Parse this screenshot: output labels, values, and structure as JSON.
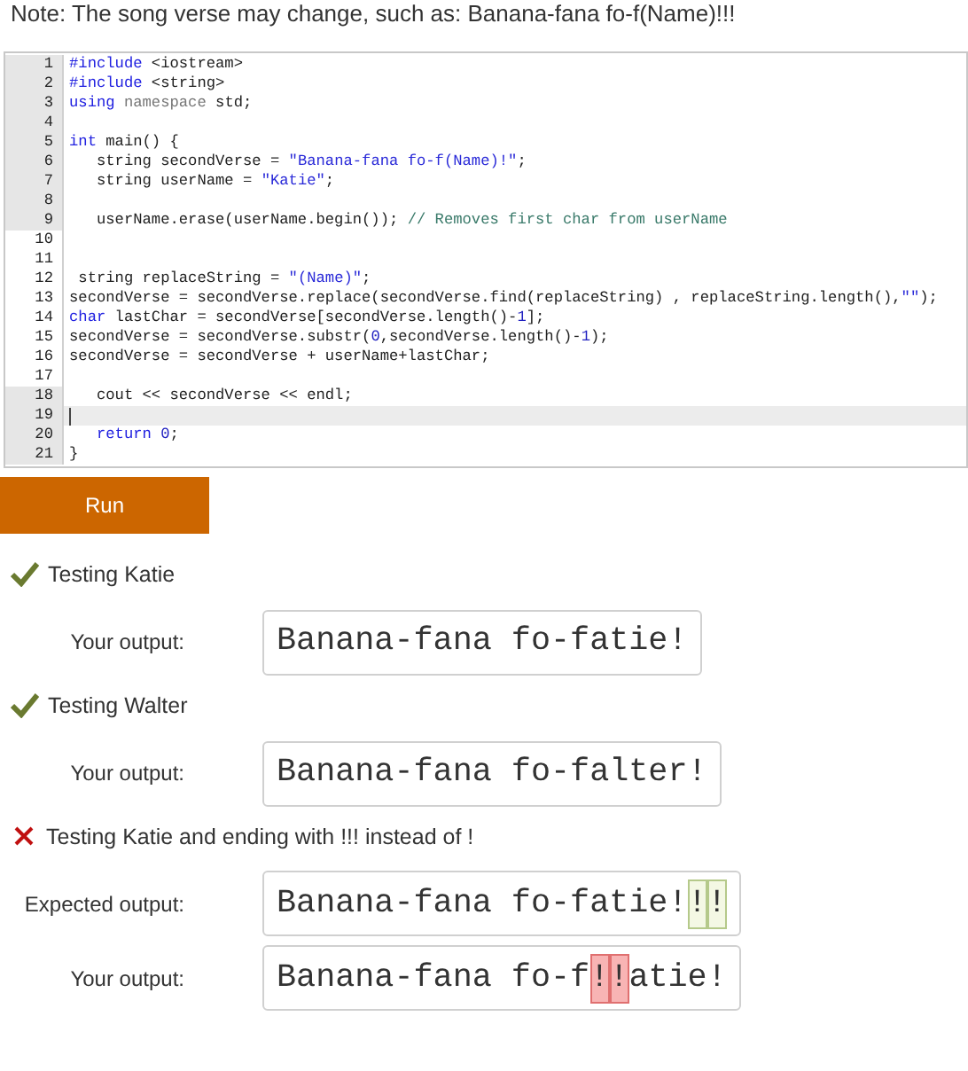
{
  "note": "Note: The song verse may change, such as: Banana-fana fo-f(Name)!!!",
  "editor": {
    "lines": [
      {
        "number": "1",
        "highlighted": true,
        "current": false,
        "tokens": [
          {
            "text": "#include",
            "kind": "keyword"
          },
          {
            "text": " <iostream>",
            "kind": "plain"
          }
        ]
      },
      {
        "number": "2",
        "highlighted": true,
        "current": false,
        "tokens": [
          {
            "text": "#include",
            "kind": "keyword"
          },
          {
            "text": " <string>",
            "kind": "plain"
          }
        ]
      },
      {
        "number": "3",
        "highlighted": true,
        "current": false,
        "tokens": [
          {
            "text": "using",
            "kind": "keyword"
          },
          {
            "text": " namespace",
            "kind": "muted"
          },
          {
            "text": " std;",
            "kind": "plain"
          }
        ]
      },
      {
        "number": "4",
        "highlighted": true,
        "current": false
      },
      {
        "number": "5",
        "highlighted": true,
        "current": false,
        "tokens": [
          {
            "text": "int",
            "kind": "keyword"
          },
          {
            "text": " main() {",
            "kind": "plain"
          }
        ]
      },
      {
        "number": "6",
        "highlighted": true,
        "current": false,
        "tokens": [
          {
            "text": "   string secondVerse = ",
            "kind": "plain"
          },
          {
            "text": "\"Banana-fana fo-f(Name)!\"",
            "kind": "string"
          },
          {
            "text": ";",
            "kind": "plain"
          }
        ]
      },
      {
        "number": "7",
        "highlighted": true,
        "current": false,
        "tokens": [
          {
            "text": "   string userName = ",
            "kind": "plain"
          },
          {
            "text": "\"Katie\"",
            "kind": "string"
          },
          {
            "text": ";",
            "kind": "plain"
          }
        ]
      },
      {
        "number": "8",
        "highlighted": true,
        "current": false
      },
      {
        "number": "9",
        "highlighted": true,
        "current": false,
        "tokens": [
          {
            "text": "   userName.erase(userName.begin()); ",
            "kind": "plain"
          },
          {
            "text": "// Removes first char from userName",
            "kind": "comment"
          }
        ]
      },
      {
        "number": "10",
        "highlighted": false,
        "current": false
      },
      {
        "number": "11",
        "highlighted": false,
        "current": false
      },
      {
        "number": "12",
        "highlighted": false,
        "current": false,
        "tokens": [
          {
            "text": " string replaceString = ",
            "kind": "plain"
          },
          {
            "text": "\"(Name)\"",
            "kind": "string"
          },
          {
            "text": ";",
            "kind": "plain"
          }
        ]
      },
      {
        "number": "13",
        "highlighted": false,
        "current": false,
        "tokens": [
          {
            "text": "secondVerse = secondVerse.replace(secondVerse.find(replaceString) , replaceString.length(),",
            "kind": "plain"
          },
          {
            "text": "\"\"",
            "kind": "string"
          },
          {
            "text": ");",
            "kind": "plain"
          }
        ]
      },
      {
        "number": "14",
        "highlighted": false,
        "current": false,
        "tokens": [
          {
            "text": "char",
            "kind": "keyword"
          },
          {
            "text": " lastChar = secondVerse[secondVerse.length()-",
            "kind": "plain"
          },
          {
            "text": "1",
            "kind": "number"
          },
          {
            "text": "];",
            "kind": "plain"
          }
        ]
      },
      {
        "number": "15",
        "highlighted": false,
        "current": false,
        "tokens": [
          {
            "text": "secondVerse = secondVerse.substr(",
            "kind": "plain"
          },
          {
            "text": "0",
            "kind": "number"
          },
          {
            "text": ",secondVerse.length()-",
            "kind": "plain"
          },
          {
            "text": "1",
            "kind": "number"
          },
          {
            "text": ");",
            "kind": "plain"
          }
        ]
      },
      {
        "number": "16",
        "highlighted": false,
        "current": false,
        "tokens": [
          {
            "text": "secondVerse = secondVerse + userName+lastChar;",
            "kind": "plain"
          }
        ]
      },
      {
        "number": "17",
        "highlighted": false,
        "current": false
      },
      {
        "number": "18",
        "highlighted": true,
        "current": false,
        "tokens": [
          {
            "text": "   cout << secondVerse << endl;",
            "kind": "plain"
          }
        ]
      },
      {
        "number": "19",
        "highlighted": true,
        "current": true
      },
      {
        "number": "20",
        "highlighted": true,
        "current": false,
        "tokens": [
          {
            "text": "   return",
            "kind": "keyword"
          },
          {
            "text": " 0",
            "kind": "number"
          },
          {
            "text": ";",
            "kind": "plain"
          }
        ]
      },
      {
        "number": "21",
        "highlighted": true,
        "current": false,
        "tokens": [
          {
            "text": "}",
            "kind": "plain"
          }
        ]
      }
    ]
  },
  "run_button": "Run",
  "tests": [
    {
      "passed": true,
      "title": "Testing Katie",
      "outputs": [
        {
          "label": "Your output:",
          "parts": [
            {
              "text": "Banana-fana fo-fatie!"
            }
          ]
        }
      ]
    },
    {
      "passed": true,
      "title": "Testing Walter",
      "outputs": [
        {
          "label": "Your output:",
          "parts": [
            {
              "text": "Banana-fana fo-falter!"
            }
          ]
        }
      ]
    },
    {
      "passed": false,
      "title": "Testing Katie and ending with !!! instead of !",
      "outputs": [
        {
          "label": "Expected output:",
          "parts": [
            {
              "text": "Banana-fana fo-fatie!"
            },
            {
              "text": "!",
              "kind": "missing"
            },
            {
              "text": "!",
              "kind": "missing"
            }
          ]
        },
        {
          "label": "Your output:",
          "parts": [
            {
              "text": "Banana-fana fo-f"
            },
            {
              "text": "!",
              "kind": "extra"
            },
            {
              "text": "!",
              "kind": "extra"
            },
            {
              "text": "atie!"
            }
          ]
        }
      ]
    }
  ]
}
